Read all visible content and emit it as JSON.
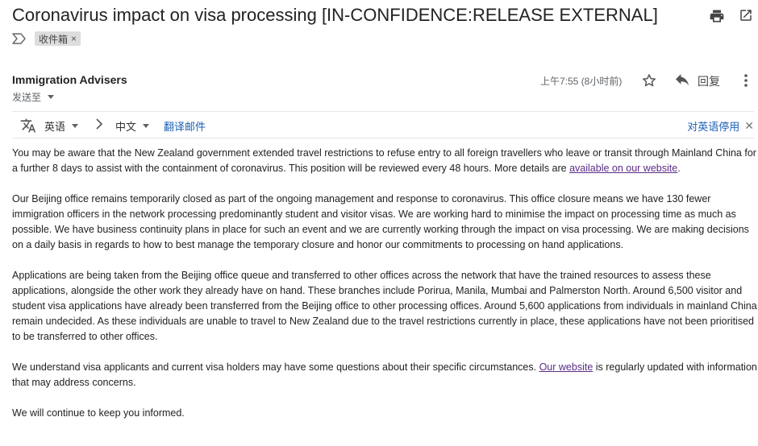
{
  "subject": "Coronavirus impact on visa processing [IN-CONFIDENCE:RELEASE EXTERNAL]",
  "labels": [
    {
      "name": "收件箱"
    }
  ],
  "header": {
    "sender": "Immigration Advisers",
    "to_label": "发送至",
    "time": "上午7:55 (8小时前)",
    "reply_label": "回复"
  },
  "translate": {
    "source_lang": "英语",
    "target_lang": "中文",
    "translate_link": "翻译邮件",
    "stop_label": "对英语停用"
  },
  "body": {
    "p1_text": "You may be aware that the New Zealand government extended travel restrictions to refuse entry to all foreign travellers who leave or transit through Mainland China for a further 8 days to assist with the containment of coronavirus. This position will be reviewed every 48 hours.  More details are ",
    "p1_link": "available on our website",
    "p1_end": ".",
    "p2": "Our Beijing office remains temporarily closed as part of the ongoing management and response to coronavirus. This office closure means we have 130 fewer immigration officers in the network processing predominantly student and visitor visas. We are working hard to minimise the impact on processing time as much as possible. We have business continuity plans in place for such an event and we are currently working through the impact on visa processing. We are making decisions on a daily basis in regards to how to best manage the temporary closure and honor our commitments to processing on hand applications.",
    "p3": "Applications are being taken from the Beijing office queue and transferred to other offices across the network that have the trained resources to assess these applications, alongside the other work they already have on hand. These branches include Porirua, Manila, Mumbai and Palmerston North.  Around 6,500 visitor and student visa applications have already been transferred from the Beijing office to other processing offices. Around 5,600 applications from individuals in mainland China remain undecided. As these individuals are unable to travel to New Zealand due to the travel restrictions currently in place, these applications have not been prioritised to be transferred to other offices.",
    "p4_text": "We understand visa applicants and current visa holders may have some questions about their specific circumstances. ",
    "p4_link": "Our website",
    "p4_end": " is regularly updated with information that may address concerns.",
    "p5": "We will continue to keep you informed."
  },
  "icons": {
    "print": "print-icon",
    "popout": "open-in-new-window-icon",
    "label": "label-arrow-icon",
    "star": "star-icon",
    "reply": "reply-icon",
    "more": "more-vertical-icon",
    "translate": "translate-icon",
    "arrow": "chevron-right-icon"
  },
  "colors": {
    "link": "#5b2b86",
    "translate_link": "#1a5fb4",
    "label_chip_bg": "#dddddd"
  }
}
